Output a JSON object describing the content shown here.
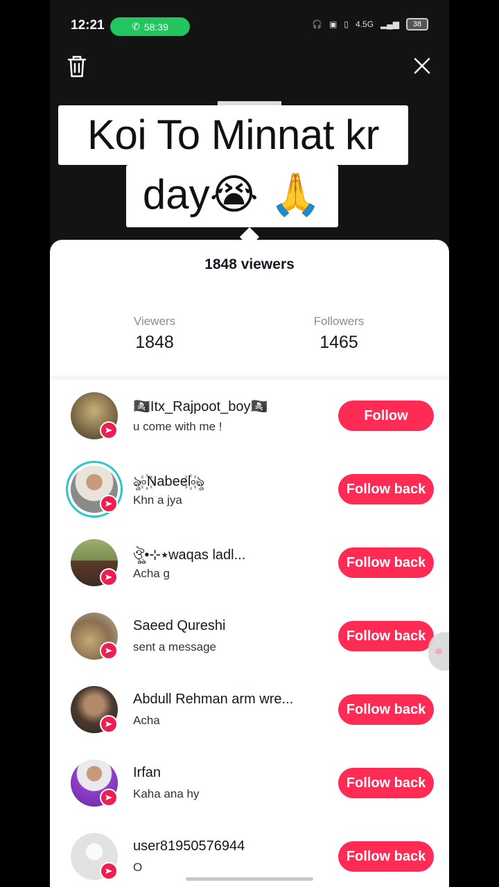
{
  "status_bar": {
    "time": "12:21",
    "call_timer": "58:39",
    "network": "4.5G",
    "battery": "38"
  },
  "caption": {
    "line1": "Koi To Minnat kr",
    "line2": "day😭 🙏"
  },
  "sheet": {
    "title": "1848 viewers",
    "stats": {
      "viewers_label": "Viewers",
      "viewers_value": "1848",
      "followers_label": "Followers",
      "followers_value": "1465"
    }
  },
  "viewers": [
    {
      "name": "🏴‍☠️Itx_Rajpoot_boy🏴‍☠️",
      "subtitle": "u come with me !",
      "button": "Follow",
      "avatar_color": "#8a7a55"
    },
    {
      "name": "ৡ৹꙰Nabeel꙰৹ৡ",
      "subtitle": "Khn a jya",
      "button": "Follow back",
      "avatar_color": "#c8c2b5"
    },
    {
      "name": "ঔৣ•⊹٭waqas ladl...",
      "subtitle": "Acha g",
      "button": "Follow back",
      "avatar_color": "#6c7a4f"
    },
    {
      "name": "Saeed Qureshi",
      "subtitle": "sent a message",
      "button": "Follow back",
      "avatar_color": "#9a8a72"
    },
    {
      "name": "Abdull Rehman arm wre...",
      "subtitle": "Acha",
      "button": "Follow back",
      "avatar_color": "#5a4a3a"
    },
    {
      "name": "Irfan",
      "subtitle": "Kaha ana hy",
      "button": "Follow back",
      "avatar_color": "#8e3fc9"
    },
    {
      "name": "user81950576944",
      "subtitle": "O",
      "button": "Follow back",
      "avatar_color": "#e6e6e6"
    }
  ],
  "colors": {
    "accent": "#fe2c55",
    "call_green": "#22c55e",
    "ring": "#2dc6c6"
  },
  "icons": {
    "trash": "trash-icon",
    "close": "close-icon",
    "badge": "send-icon"
  }
}
